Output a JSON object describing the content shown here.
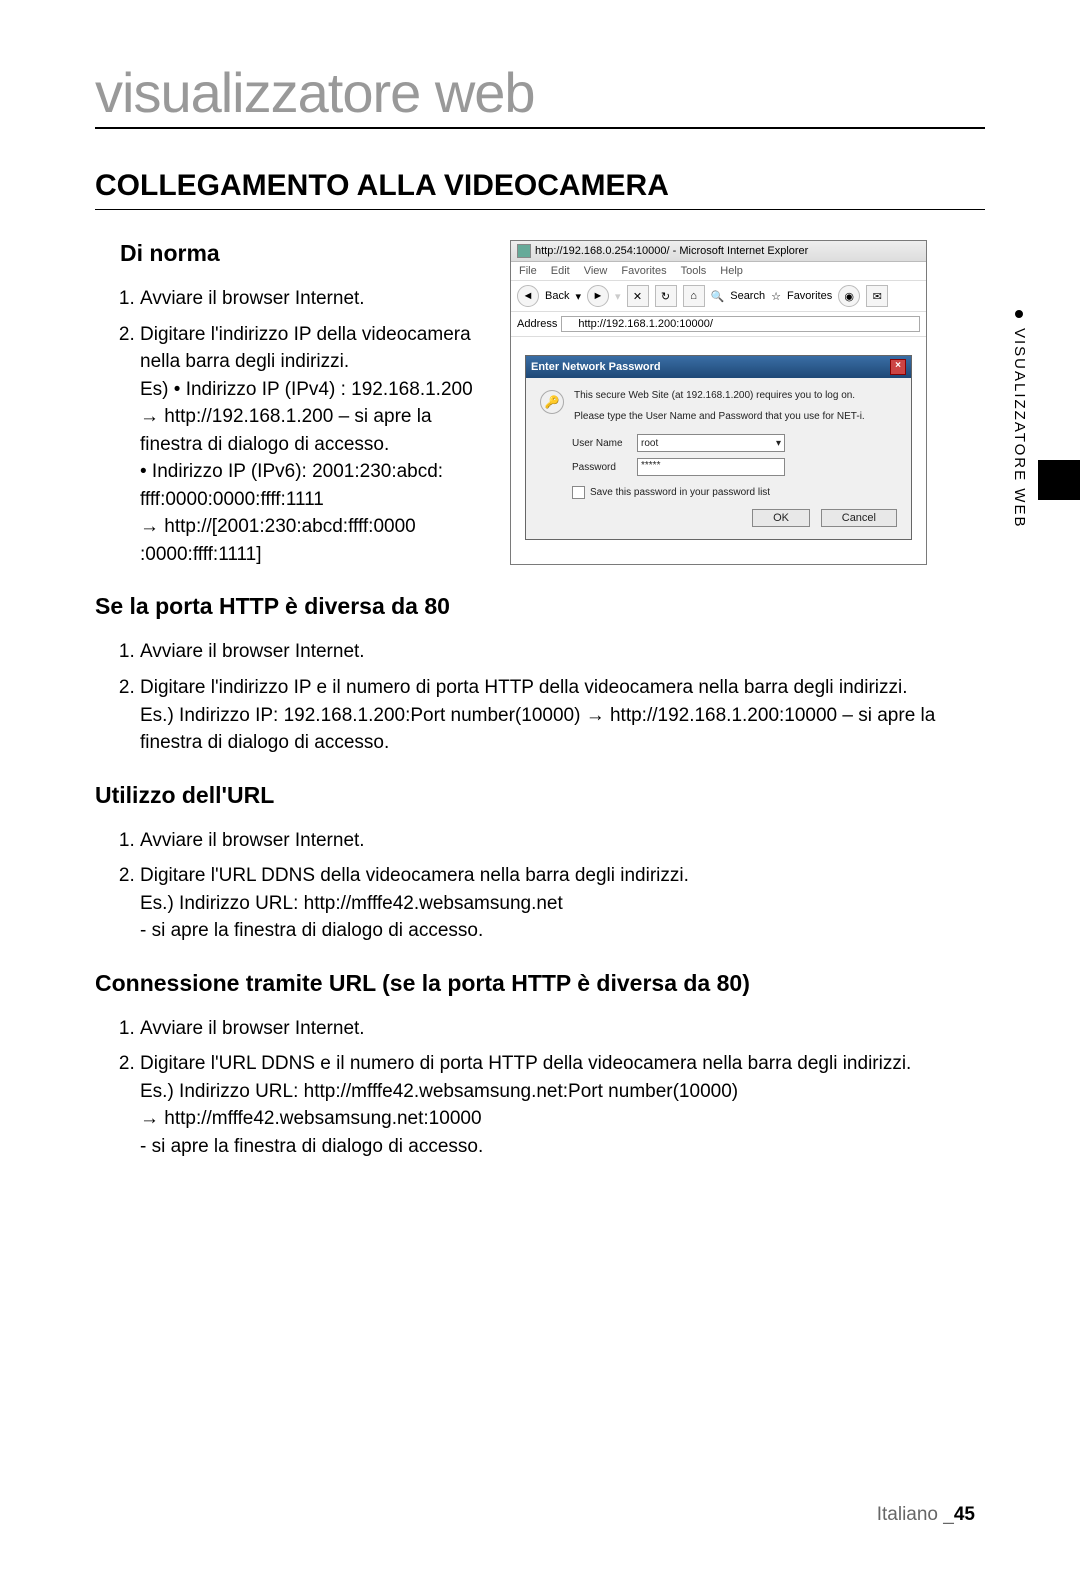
{
  "mainTitle": "visualizzatore web",
  "sectionTitle": "COLLEGAMENTO ALLA VIDEOCAMERA",
  "sideTab": "VISUALIZZATORE WEB",
  "sub1": {
    "heading": "Di norma",
    "item1": "Avviare il browser Internet.",
    "item2a": "Digitare l'indirizzo IP della videocamera nella barra degli indirizzi.",
    "item2b": "Es) • Indirizzo IP (IPv4) : 192.168.1.200",
    "item2c": "→ http://192.168.1.200 – si apre la finestra di dialogo di accesso.",
    "item2d": "• Indirizzo IP (IPv6): 2001:230:abcd: ffff:0000:0000:ffff:1111",
    "item2e": "→ http://[2001:230:abcd:ffff:0000 :0000:ffff:1111]"
  },
  "sub2": {
    "heading": "Se la porta HTTP è diversa da 80",
    "item1": "Avviare il browser Internet.",
    "item2a": "Digitare l'indirizzo IP e il numero di porta HTTP della videocamera nella barra degli indirizzi.",
    "item2b": "Es.) Indirizzo IP: 192.168.1.200:Port number(10000) → http://192.168.1.200:10000 – si apre la finestra di dialogo di accesso."
  },
  "sub3": {
    "heading": "Utilizzo dell'URL",
    "item1": "Avviare il browser Internet.",
    "item2a": "Digitare l'URL DDNS della videocamera nella barra degli indirizzi.",
    "item2b": "Es.) Indirizzo URL: http://mfffe42.websamsung.net",
    "item2c": "-  si apre la finestra di dialogo di accesso."
  },
  "sub4": {
    "heading": "Connessione tramite URL (se la porta HTTP è diversa da 80)",
    "item1": "Avviare il browser Internet.",
    "item2a": "Digitare l'URL DDNS e il numero di porta HTTP della videocamera nella barra degli indirizzi.",
    "item2b": "Es.) Indirizzo URL: http://mfffe42.websamsung.net:Port number(10000)",
    "item2c": "→ http://mfffe42.websamsung.net:10000",
    "item2d": "-  si apre la finestra di dialogo di accesso."
  },
  "ie": {
    "title": "http://192.168.0.254:10000/ - Microsoft Internet Explorer",
    "menu": {
      "file": "File",
      "edit": "Edit",
      "view": "View",
      "fav": "Favorites",
      "tools": "Tools",
      "help": "Help"
    },
    "back": "Back",
    "search": "Search",
    "favorites": "Favorites",
    "addressLabel": "Address",
    "addressValue": "http://192.168.1.200:10000/",
    "dlgTitle": "Enter Network Password",
    "dlgLine1": "This secure Web Site (at 192.168.1.200) requires you to log on.",
    "dlgLine2": "Please type the User Name and Password that you use for NET-i.",
    "userLabel": "User Name",
    "userValue": "root",
    "passLabel": "Password",
    "passValue": "*****",
    "saveChk": "Save this password in your password list",
    "ok": "OK",
    "cancel": "Cancel"
  },
  "footer": {
    "lang": "Italiano _",
    "page": "45"
  }
}
